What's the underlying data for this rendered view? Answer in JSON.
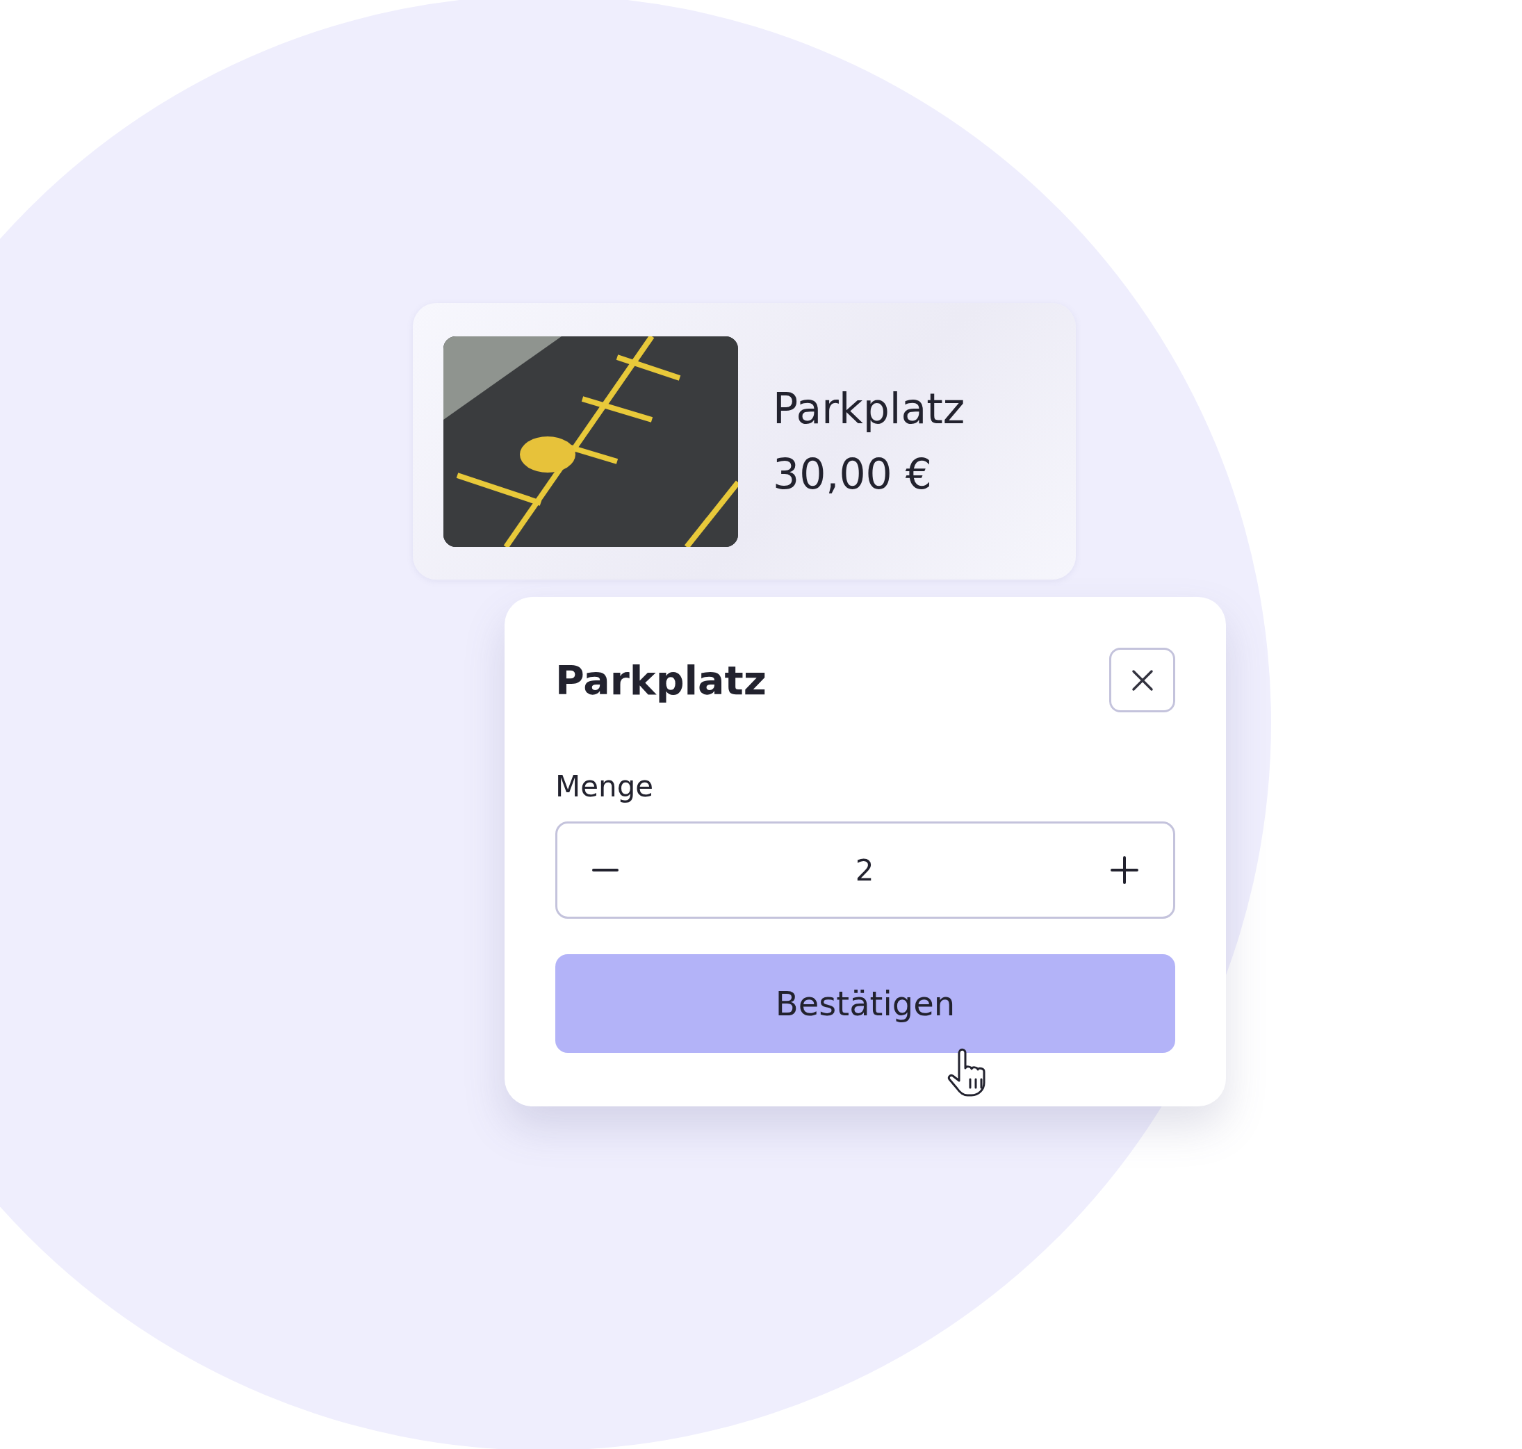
{
  "product_card": {
    "title": "Parkplatz",
    "price": "30,00 €"
  },
  "dialog": {
    "title": "Parkplatz",
    "quantity_label": "Menge",
    "quantity": "2",
    "confirm_button": "Bestätigen"
  }
}
